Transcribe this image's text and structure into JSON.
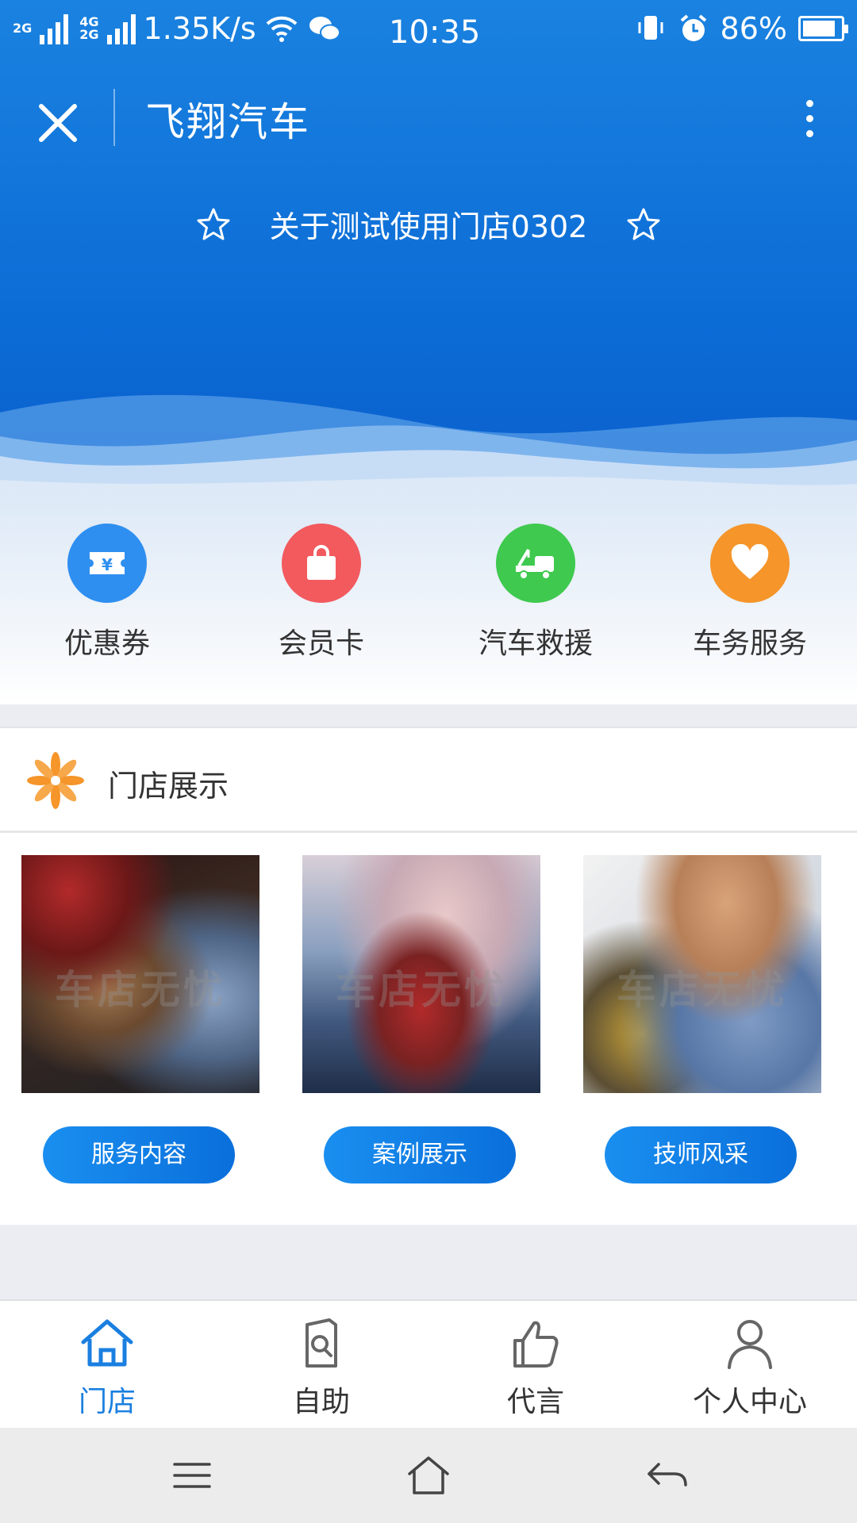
{
  "status_bar": {
    "net_2g": "2G",
    "net_4g": "4G",
    "net_2g_b": "2G",
    "speed": "1.35K/s",
    "time": "10:35",
    "battery": "86%",
    "battery_level": 0.86
  },
  "titlebar": {
    "title": "飞翔汽车"
  },
  "store": {
    "name": "关于测试使用门店0302"
  },
  "quick_actions": [
    {
      "label": "优惠券",
      "color": "#2f8ff0",
      "icon": "coupon-icon"
    },
    {
      "label": "会员卡",
      "color": "#f25a5e",
      "icon": "shopping-bag-icon"
    },
    {
      "label": "汽车救援",
      "color": "#3fc94f",
      "icon": "tow-truck-icon"
    },
    {
      "label": "车务服务",
      "color": "#f5952a",
      "icon": "heart-icon"
    }
  ],
  "showcase": {
    "title": "门店展示",
    "items": [
      {
        "button": "服务内容",
        "watermark": "车店无忧"
      },
      {
        "button": "案例展示",
        "watermark": "车店无忧"
      },
      {
        "button": "技师风采",
        "watermark": "车店无忧"
      }
    ]
  },
  "tabbar": [
    {
      "label": "门店",
      "icon": "home-icon",
      "active": true
    },
    {
      "label": "自助",
      "icon": "self-service-icon",
      "active": false
    },
    {
      "label": "代言",
      "icon": "thumbs-up-icon",
      "active": false
    },
    {
      "label": "个人中心",
      "icon": "user-icon",
      "active": false
    }
  ],
  "colors": {
    "primary": "#1a7fe0",
    "accent_orange": "#f5952a"
  }
}
